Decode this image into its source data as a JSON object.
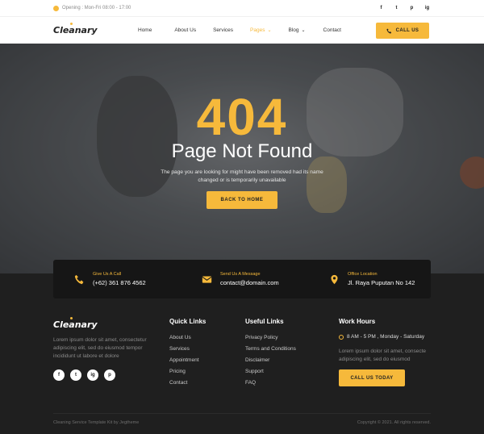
{
  "topbar": {
    "opening": "Opening : Mon-Fri 08:00 - 17:00",
    "socials": [
      "f",
      "t",
      "p",
      "ig"
    ]
  },
  "nav": {
    "logo": "Cleanary",
    "items": [
      {
        "label": "Home"
      },
      {
        "label": "About Us"
      },
      {
        "label": "Services"
      },
      {
        "label": "Pages",
        "active": true,
        "chevron": "⌄"
      },
      {
        "label": "Blog",
        "chevron": "⌄"
      },
      {
        "label": "Contact"
      }
    ],
    "call_label": "CALL US",
    "call_icon": "phone-icon"
  },
  "hero": {
    "code": "404",
    "heading": "Page Not Found",
    "message": "The page you are looking for might have been removed had its name changed or is temporarily unavailable",
    "button": "BACK TO HOME"
  },
  "contact": [
    {
      "icon": "phone-icon",
      "label": "Give Us A Call",
      "value": "(+62) 361 876 4562"
    },
    {
      "icon": "envelope-icon",
      "label": "Send Us A Message",
      "value": "contact@domain.com"
    },
    {
      "icon": "map-pin-icon",
      "label": "Office Location",
      "value": "Jl. Raya Puputan No 142"
    }
  ],
  "footer": {
    "logo": "Cleanary",
    "description": "Lorem ipsum dolor sit amet, consectetur adipiscing elit, sed do eiusmod tempor incididunt ut labore et dolore",
    "socials": [
      "f",
      "t",
      "ig",
      "p"
    ],
    "quick_links": {
      "title": "Quick Links",
      "items": [
        "About Us",
        "Services",
        "Appointment",
        "Pricing",
        "Contact"
      ]
    },
    "useful_links": {
      "title": "Useful Links",
      "items": [
        "Privacy Policy",
        "Terms and Conditions",
        "Disclaimer",
        "Support",
        "FAQ"
      ]
    },
    "work_hours": {
      "title": "Work Hours",
      "hours": "8 AM - 5 PM , Monday - Saturday",
      "description": "Lorem ipsum dolor sit amet, consecte adipiscing elit, sed do eiusmod",
      "button": "CALL US TODAY"
    },
    "copyright_left": "Cleaning Service Template Kit by Jegtheme",
    "copyright_right": "Copyright © 2021. All rights reserved."
  },
  "colors": {
    "accent": "#f6b93b",
    "dark": "#1f1f1f"
  }
}
